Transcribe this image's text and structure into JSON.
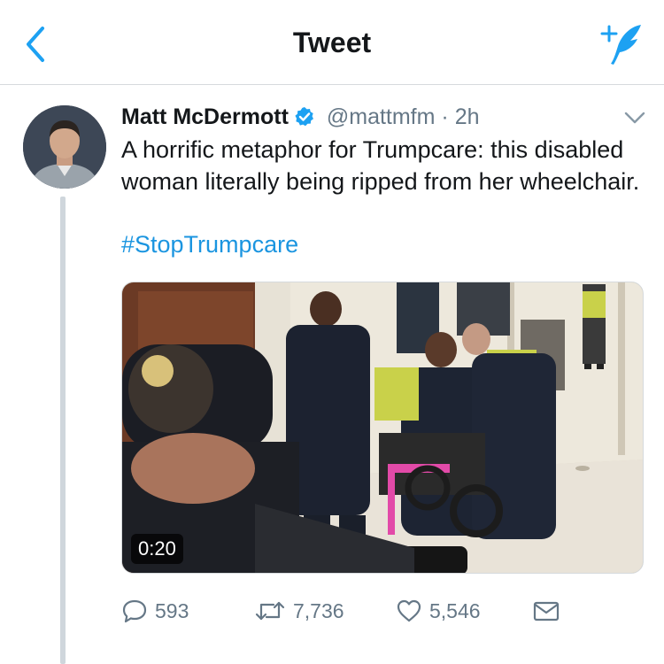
{
  "nav": {
    "title": "Tweet",
    "back_icon": "back-chevron-icon",
    "compose_icon": "compose-tweet-icon",
    "accent": "#1da1f2"
  },
  "tweet": {
    "author_name": "Matt McDermott",
    "verified_icon": "verified-badge-icon",
    "handle": "@mattmfm",
    "dot": "·",
    "time": "2h",
    "text": "A horrific metaphor for Trumpcare: this disabled woman literally being ripped from her wheelchair.",
    "hashtag": "#StopTrumpcare",
    "hashtag_color": "#1b95e0"
  },
  "media": {
    "type": "video",
    "duration": "0:20"
  },
  "actions": {
    "replies": "593",
    "retweets": "7,736",
    "likes": "5,546",
    "reply_icon": "reply-icon",
    "retweet_icon": "retweet-icon",
    "like_icon": "heart-icon",
    "dm_icon": "direct-message-icon"
  }
}
